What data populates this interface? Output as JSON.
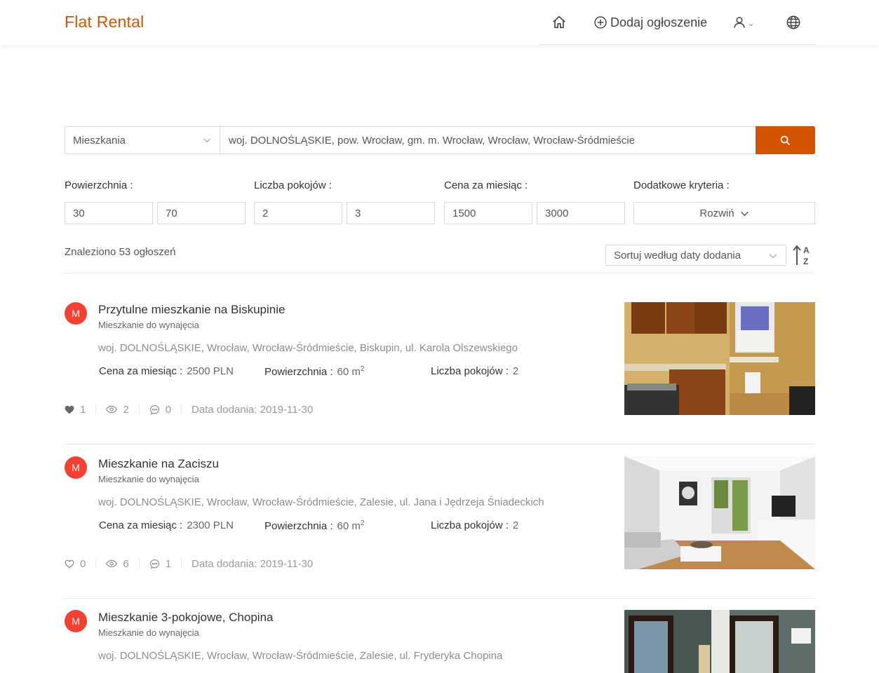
{
  "header": {
    "brand": "Flat Rental",
    "add_listing": "Dodaj ogłoszenie",
    "icons": [
      "home-icon",
      "plus-circle-icon",
      "user-icon",
      "chevron-down-icon",
      "globe-icon"
    ]
  },
  "search": {
    "type_value": "Mieszkania",
    "location_value": "woj. DOLNOŚLĄSKIE, pow. Wrocław, gm. m. Wrocław, Wrocław, Wrocław-Śródmieście"
  },
  "filters": {
    "area_label": "Powierzchnia :",
    "area_min": "30",
    "area_max": "70",
    "rooms_label": "Liczba pokojów :",
    "rooms_min": "2",
    "rooms_max": "3",
    "price_label": "Cena za miesiąc :",
    "price_min": "1500",
    "price_max": "3000",
    "extra_label": "Dodatkowe kryteria :",
    "expand_label": "Rozwiń"
  },
  "results": {
    "found_text": "Znaleziono 53 ogłoszeń",
    "sort_value": "Sortuj według daty dodania"
  },
  "listings": [
    {
      "avatar": "M",
      "title": "Przytulne mieszkanie na Biskupinie",
      "subtitle": "Mieszkanie do wynajęcia",
      "address": "woj. DOLNOŚLĄSKIE, Wrocław, Wrocław-Śródmieście, Biskupin, ul. Karola Olszewskiego",
      "price_label": "Cena za miesiąc :",
      "price": "2500 PLN",
      "area_label": "Powierzchnia :",
      "area": "60 m",
      "area_unit_sup": "2",
      "rooms_label": "Liczba pokojów :",
      "rooms": "2",
      "likes": "1",
      "liked": true,
      "views": "2",
      "comments": "0",
      "date": "Data dodania: 2019-11-30"
    },
    {
      "avatar": "M",
      "title": "Mieszkanie na Zaciszu",
      "subtitle": "Mieszkanie do wynajęcia",
      "address": "woj. DOLNOŚLĄSKIE, Wrocław, Wrocław-Śródmieście, Zalesie, ul. Jana i Jędrzeja Śniadeckich",
      "price_label": "Cena za miesiąc :",
      "price": "2300 PLN",
      "area_label": "Powierzchnia :",
      "area": "60 m",
      "area_unit_sup": "2",
      "rooms_label": "Liczba pokojów :",
      "rooms": "2",
      "likes": "0",
      "liked": false,
      "views": "6",
      "comments": "1",
      "date": "Data dodania: 2019-11-30"
    },
    {
      "avatar": "M",
      "title": "Mieszkanie 3-pokojowe, Chopina",
      "subtitle": "Mieszkanie do wynajęcia",
      "address": "woj. DOLNOŚLĄSKIE, Wrocław, Wrocław-Śródmieście, Zalesie, ul. Fryderyka Chopina"
    }
  ],
  "colors": {
    "brand": "#d35400",
    "avatar": "#f04134",
    "border": "#d9d9d9"
  }
}
